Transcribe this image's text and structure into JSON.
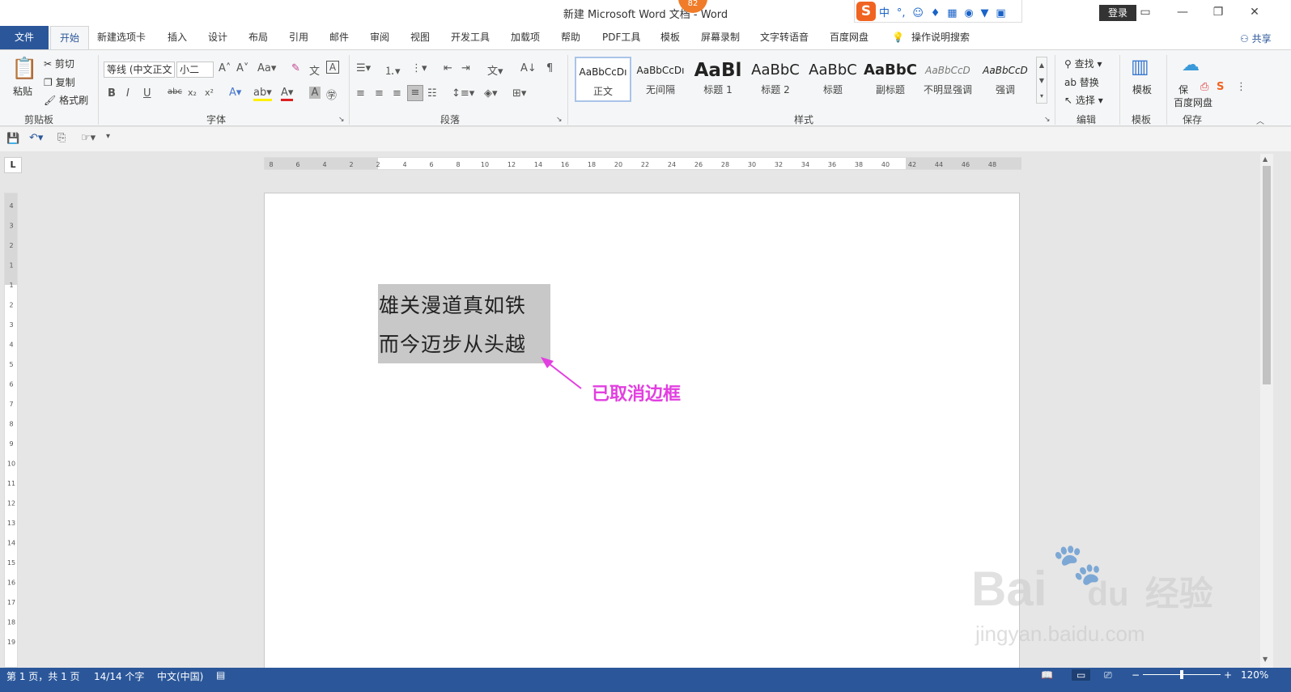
{
  "window": {
    "title": "新建 Microsoft Word 文档 - Word",
    "login_label": "登录",
    "ime_notification_count": "82",
    "ime_lang": "中"
  },
  "tabs": [
    "文件",
    "开始",
    "新建选项卡",
    "插入",
    "设计",
    "布局",
    "引用",
    "邮件",
    "审阅",
    "视图",
    "开发工具",
    "加载项",
    "帮助",
    "PDF工具",
    "模板",
    "屏幕录制",
    "文字转语音",
    "百度网盘"
  ],
  "tell_me": "操作说明搜索",
  "share_label": "共享",
  "ribbon": {
    "clipboard": {
      "paste": "粘贴",
      "cut": "剪切",
      "copy": "复制",
      "format_painter": "格式刷",
      "label": "剪贴板"
    },
    "font": {
      "font_name": "等线 (中文正文",
      "font_size": "小二",
      "label": "字体"
    },
    "paragraph": {
      "label": "段落"
    },
    "styles": {
      "label": "样式",
      "items": [
        {
          "preview": "AaBbCcDı",
          "name": "正文"
        },
        {
          "preview": "AaBbCcDı",
          "name": "无间隔"
        },
        {
          "preview": "AaBl",
          "name": "标题 1"
        },
        {
          "preview": "AaBbC",
          "name": "标题 2"
        },
        {
          "preview": "AaBbC",
          "name": "标题"
        },
        {
          "preview": "AaBbC",
          "name": "副标题"
        },
        {
          "preview": "AaBbCcD",
          "name": "不明显强调"
        },
        {
          "preview": "AaBbCcD",
          "name": "强调"
        }
      ]
    },
    "editing": {
      "find": "查找",
      "replace": "替换",
      "select": "选择",
      "label": "编辑"
    },
    "template": {
      "button": "模板",
      "label": "模板"
    },
    "save": {
      "button_line1": "保",
      "button_line2": "百度网盘",
      "label": "保存"
    }
  },
  "document": {
    "lines": [
      "雄关漫道真如铁",
      "而今迈步从头越"
    ],
    "annotation": "已取消边框"
  },
  "rulers": {
    "horizontal_ticks": [
      "8",
      "6",
      "4",
      "2",
      "2",
      "4",
      "6",
      "8",
      "10",
      "12",
      "14",
      "16",
      "18",
      "20",
      "22",
      "24",
      "26",
      "28",
      "30",
      "32",
      "34",
      "36",
      "38",
      "40",
      "42",
      "44",
      "46",
      "48"
    ],
    "vertical_ticks": [
      "4",
      "3",
      "2",
      "1",
      "1",
      "2",
      "3",
      "4",
      "5",
      "6",
      "7",
      "8",
      "9",
      "10",
      "11",
      "12",
      "13",
      "14",
      "15",
      "16",
      "17",
      "18",
      "19"
    ]
  },
  "status": {
    "page": "第 1 页，共 1 页",
    "words": "14/14 个字",
    "language": "中文(中国)",
    "zoom": "120%"
  },
  "watermark": {
    "brand": "Bai",
    "brand2": "du",
    "suffix": "经验",
    "url": "jingyan.baidu.com"
  },
  "colors": {
    "accent": "#2b579a",
    "annotation": "#e23fe0",
    "selection": "#c8c8c8"
  }
}
